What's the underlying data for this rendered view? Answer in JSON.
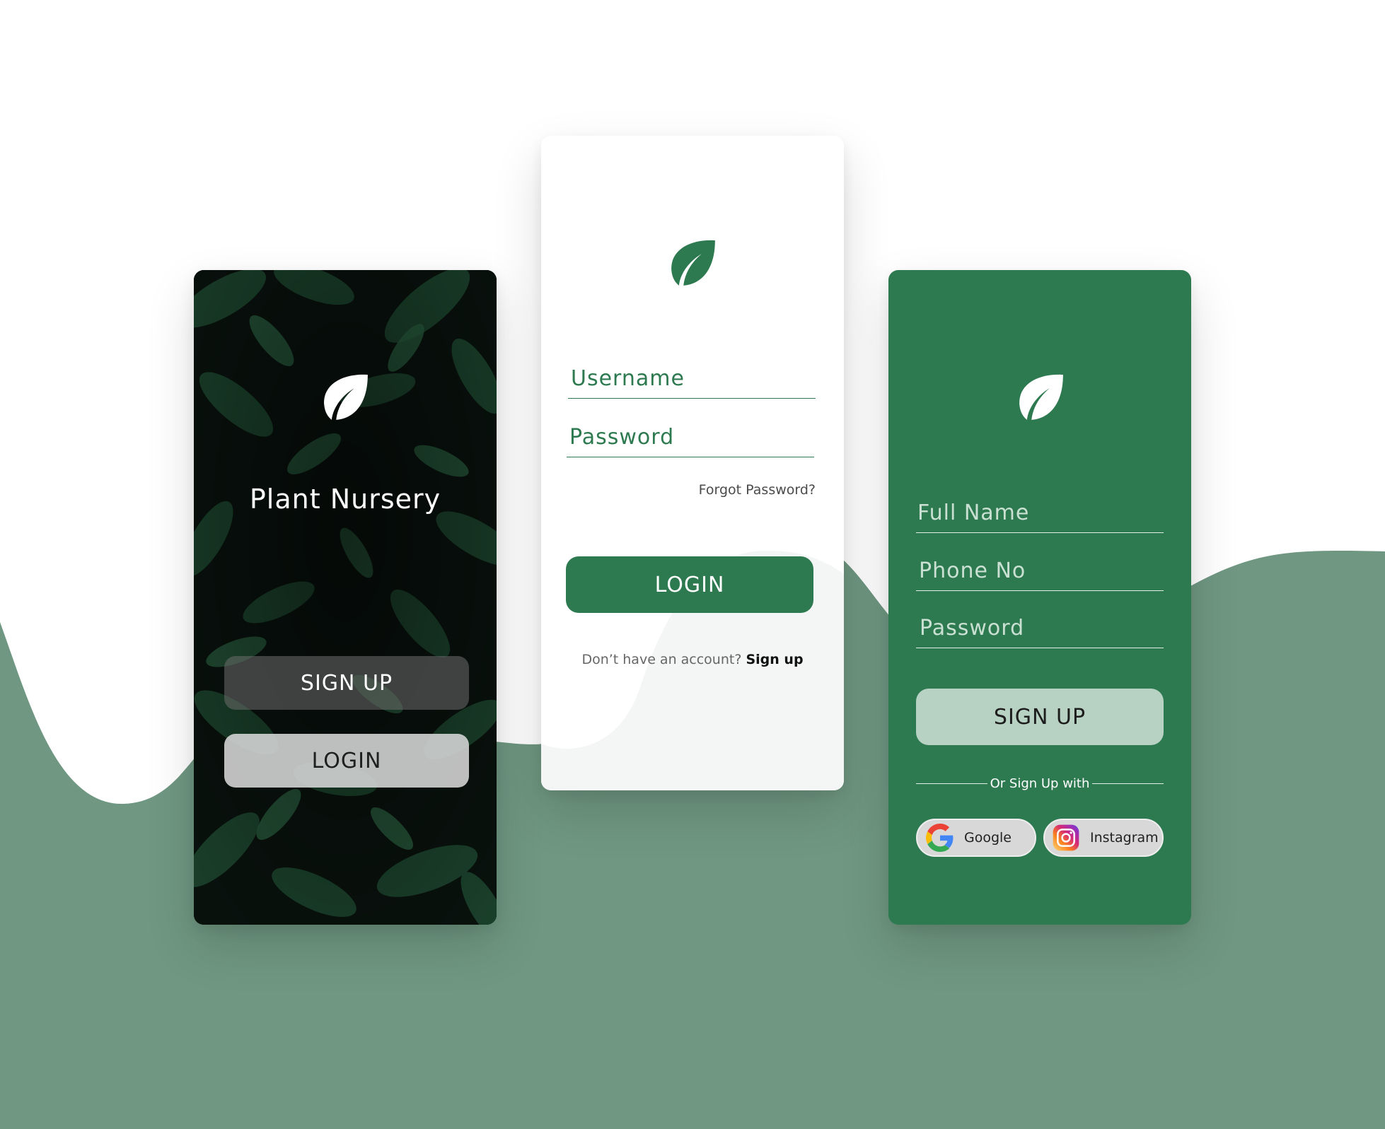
{
  "colors": {
    "brand_green": "#2e7a50",
    "wave_green": "#6f9781",
    "welcome_bg": "#070b09",
    "signup_button": "#b7d1c3"
  },
  "welcome": {
    "logo_icon": "leaf-icon",
    "title": "Plant Nursery",
    "signup_label": "SIGN UP",
    "login_label": "LOGIN"
  },
  "login": {
    "logo_icon": "leaf-icon",
    "username_placeholder": "Username",
    "password_placeholder": "Password",
    "forgot_label": "Forgot Password?",
    "login_label": "LOGIN",
    "no_account_text": "Don’t have an account?",
    "signup_link": "Sign up"
  },
  "signup": {
    "logo_icon": "leaf-icon",
    "fullname_placeholder": "Full Name",
    "phone_placeholder": "Phone No",
    "password_placeholder": "Password",
    "signup_label": "SIGN UP",
    "divider_text": "Or Sign Up with",
    "google_label": "Google",
    "instagram_label": "Instagram"
  }
}
